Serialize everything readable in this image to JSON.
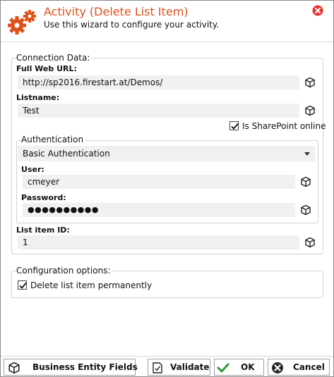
{
  "header": {
    "title": "Activity (Delete List Item)",
    "subtitle": "Use this wizard to configure your activity.",
    "close_icon": "close-circle-icon"
  },
  "colors": {
    "title": "#e0501b",
    "logo": "#e0501b",
    "close": "#e8312c",
    "ok_check": "#2e9b3a"
  },
  "connection": {
    "legend": "Connection Data:",
    "web_url_label": "Full Web URL:",
    "web_url_value": "http://sp2016.firestart.at/Demos/",
    "listname_label": "Listname:",
    "listname_value": "Test",
    "sharepoint_online_label": "Is SharePoint online",
    "sharepoint_online_checked": true,
    "auth": {
      "legend": "Authentication",
      "method": "Basic Authentication",
      "user_label": "User:",
      "user_value": "cmeyer",
      "password_label": "Password:",
      "password_value": "●●●●●●●●●●"
    },
    "item_id_label": "List item ID:",
    "item_id_value": "1"
  },
  "config": {
    "legend": "Configuration options:",
    "delete_permanently_label": "Delete list item permanently",
    "delete_permanently_checked": true
  },
  "footer": {
    "business_entity_label": "Business Entity Fields",
    "validate_label": "Validate",
    "ok_label": "OK",
    "cancel_label": "Cancel"
  }
}
